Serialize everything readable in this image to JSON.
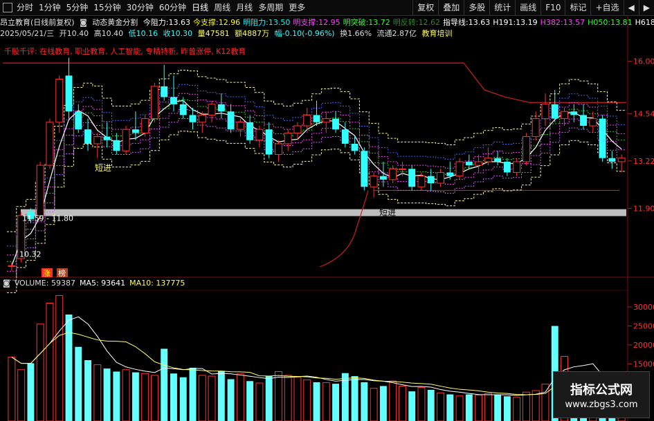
{
  "toolbar": {
    "periods": [
      "分时",
      "1分钟",
      "5分钟",
      "15分钟",
      "30分钟",
      "60分钟",
      "日线",
      "周线",
      "月线",
      "多周期",
      "更多"
    ],
    "active": "日线",
    "right": [
      "复权",
      "叠加",
      "多股",
      "统计",
      "画线",
      "F10",
      "标记",
      "+自选",
      "◀",
      "▶"
    ]
  },
  "info_line1": {
    "title": "昂立教育(日线前复权)",
    "indicator": "动态黄金分割",
    "items": [
      {
        "label": "今阻力:",
        "value": "13.63",
        "color": "#ffffff"
      },
      {
        "label": "今支撑:",
        "value": "12.96",
        "color": "#ffff00"
      },
      {
        "label": "明阻力:",
        "value": "13.50",
        "color": "#00ffff"
      },
      {
        "label": "明支撑:",
        "value": "12.95",
        "color": "#ff44ff"
      },
      {
        "label": "明突破:",
        "value": "13.72",
        "color": "#33ff33"
      },
      {
        "label": "明反转:",
        "value": "12.62",
        "color": "#338833"
      },
      {
        "label": "指导线:",
        "value": "13.63",
        "color": "#ffffff"
      },
      {
        "label": "H191:",
        "value": "13.19",
        "color": "#ffffff"
      },
      {
        "label": "H382:",
        "value": "13.57",
        "color": "#ff44ff"
      },
      {
        "label": "H050:",
        "value": "13.81",
        "color": "#33ff33"
      },
      {
        "label": "H618:",
        "value": "1",
        "color": "#ffffff"
      }
    ]
  },
  "info_line2": {
    "date": "2025/05/21/三",
    "open": "开10.40",
    "high": "高10.40",
    "low": "低10.16",
    "close": "收10.30",
    "volume": "量47581",
    "amount": "额4887万",
    "change": "幅-0.10(-0.96%)",
    "turnover": "换1.66%",
    "float": "流通2.87亿",
    "extra": "教育培训"
  },
  "annotation": "千股千评: 在线教育, 职业教育, 人工智能, 专精特新, 昨曾涨停, K12教育",
  "chart_data": [
    {
      "type": "candlestick",
      "name": "price",
      "yaxis_ticks": [
        16.0,
        14.54,
        13.22,
        11.9
      ],
      "text_labels": [
        "11.59 - 11.80",
        "10.32",
        "短进",
        "短进",
        "涨",
        "榜"
      ],
      "candles": [
        {
          "o": 10.3,
          "h": 10.4,
          "l": 10.16,
          "c": 10.3
        },
        {
          "o": 10.5,
          "h": 11.8,
          "l": 10.4,
          "c": 11.7
        },
        {
          "o": 11.8,
          "h": 11.9,
          "l": 11.5,
          "c": 11.6
        },
        {
          "o": 11.7,
          "h": 13.2,
          "l": 11.6,
          "c": 13.1
        },
        {
          "o": 13.1,
          "h": 14.4,
          "l": 13.0,
          "c": 14.3
        },
        {
          "o": 14.3,
          "h": 15.6,
          "l": 14.0,
          "c": 15.5
        },
        {
          "o": 15.6,
          "h": 16.1,
          "l": 14.4,
          "c": 14.6
        },
        {
          "o": 14.6,
          "h": 14.8,
          "l": 14.0,
          "c": 14.1
        },
        {
          "o": 14.1,
          "h": 14.4,
          "l": 13.5,
          "c": 13.7
        },
        {
          "o": 13.7,
          "h": 14.0,
          "l": 13.3,
          "c": 13.9
        },
        {
          "o": 13.9,
          "h": 14.3,
          "l": 13.6,
          "c": 13.8
        },
        {
          "o": 13.8,
          "h": 14.0,
          "l": 13.4,
          "c": 13.5
        },
        {
          "o": 13.5,
          "h": 14.2,
          "l": 13.4,
          "c": 14.1
        },
        {
          "o": 14.1,
          "h": 14.6,
          "l": 13.8,
          "c": 14.0
        },
        {
          "o": 14.0,
          "h": 14.5,
          "l": 13.9,
          "c": 14.4
        },
        {
          "o": 14.4,
          "h": 15.4,
          "l": 14.3,
          "c": 15.3
        },
        {
          "o": 15.3,
          "h": 15.9,
          "l": 14.9,
          "c": 15.0
        },
        {
          "o": 15.0,
          "h": 15.6,
          "l": 14.6,
          "c": 14.8
        },
        {
          "o": 14.8,
          "h": 15.0,
          "l": 14.4,
          "c": 14.5
        },
        {
          "o": 14.5,
          "h": 14.7,
          "l": 14.1,
          "c": 14.3
        },
        {
          "o": 14.3,
          "h": 14.6,
          "l": 14.0,
          "c": 14.5
        },
        {
          "o": 14.5,
          "h": 14.9,
          "l": 14.3,
          "c": 14.8
        },
        {
          "o": 14.8,
          "h": 15.1,
          "l": 14.4,
          "c": 14.6
        },
        {
          "o": 14.6,
          "h": 14.8,
          "l": 14.0,
          "c": 14.1
        },
        {
          "o": 14.1,
          "h": 14.4,
          "l": 13.9,
          "c": 14.3
        },
        {
          "o": 14.3,
          "h": 14.5,
          "l": 13.7,
          "c": 13.8
        },
        {
          "o": 13.8,
          "h": 14.2,
          "l": 13.6,
          "c": 14.1
        },
        {
          "o": 14.1,
          "h": 14.3,
          "l": 13.3,
          "c": 13.4
        },
        {
          "o": 13.4,
          "h": 13.8,
          "l": 13.2,
          "c": 13.7
        },
        {
          "o": 13.7,
          "h": 14.1,
          "l": 13.5,
          "c": 14.0
        },
        {
          "o": 14.0,
          "h": 14.3,
          "l": 13.8,
          "c": 14.2
        },
        {
          "o": 14.2,
          "h": 14.7,
          "l": 14.0,
          "c": 14.5
        },
        {
          "o": 14.5,
          "h": 14.9,
          "l": 14.2,
          "c": 14.3
        },
        {
          "o": 14.3,
          "h": 14.6,
          "l": 14.0,
          "c": 14.4
        },
        {
          "o": 14.4,
          "h": 14.6,
          "l": 14.0,
          "c": 14.1
        },
        {
          "o": 14.1,
          "h": 14.3,
          "l": 13.6,
          "c": 13.7
        },
        {
          "o": 13.7,
          "h": 13.9,
          "l": 13.4,
          "c": 13.5
        },
        {
          "o": 13.5,
          "h": 13.6,
          "l": 12.4,
          "c": 12.5
        },
        {
          "o": 12.5,
          "h": 12.9,
          "l": 12.2,
          "c": 12.8
        },
        {
          "o": 12.8,
          "h": 13.2,
          "l": 12.5,
          "c": 12.7
        },
        {
          "o": 12.7,
          "h": 13.1,
          "l": 12.6,
          "c": 13.0
        },
        {
          "o": 13.0,
          "h": 13.2,
          "l": 12.8,
          "c": 13.0
        },
        {
          "o": 13.0,
          "h": 13.1,
          "l": 12.4,
          "c": 12.5
        },
        {
          "o": 12.5,
          "h": 12.9,
          "l": 12.4,
          "c": 12.8
        },
        {
          "o": 12.8,
          "h": 13.0,
          "l": 12.4,
          "c": 12.6
        },
        {
          "o": 12.6,
          "h": 13.0,
          "l": 12.5,
          "c": 12.9
        },
        {
          "o": 12.9,
          "h": 13.2,
          "l": 12.7,
          "c": 12.8
        },
        {
          "o": 12.8,
          "h": 13.3,
          "l": 12.7,
          "c": 13.2
        },
        {
          "o": 13.2,
          "h": 13.4,
          "l": 13.0,
          "c": 13.1
        },
        {
          "o": 13.1,
          "h": 13.4,
          "l": 12.9,
          "c": 13.2
        },
        {
          "o": 13.2,
          "h": 13.6,
          "l": 13.1,
          "c": 13.3
        },
        {
          "o": 13.3,
          "h": 13.5,
          "l": 13.1,
          "c": 13.2
        },
        {
          "o": 13.2,
          "h": 13.3,
          "l": 12.8,
          "c": 12.9
        },
        {
          "o": 12.9,
          "h": 13.3,
          "l": 12.8,
          "c": 13.2
        },
        {
          "o": 13.2,
          "h": 14.0,
          "l": 13.1,
          "c": 13.9
        },
        {
          "o": 13.9,
          "h": 14.6,
          "l": 13.8,
          "c": 14.4
        },
        {
          "o": 14.4,
          "h": 15.1,
          "l": 14.2,
          "c": 14.8
        },
        {
          "o": 14.8,
          "h": 15.2,
          "l": 14.3,
          "c": 14.4
        },
        {
          "o": 14.4,
          "h": 14.7,
          "l": 14.2,
          "c": 14.6
        },
        {
          "o": 14.6,
          "h": 14.8,
          "l": 14.3,
          "c": 14.5
        },
        {
          "o": 14.5,
          "h": 14.8,
          "l": 14.1,
          "c": 14.2
        },
        {
          "o": 14.2,
          "h": 14.6,
          "l": 14.0,
          "c": 14.4
        },
        {
          "o": 14.4,
          "h": 14.5,
          "l": 13.2,
          "c": 13.3
        },
        {
          "o": 13.3,
          "h": 13.5,
          "l": 13.0,
          "c": 13.2
        },
        {
          "o": 13.2,
          "h": 13.4,
          "l": 12.9,
          "c": 13.3
        }
      ]
    },
    {
      "type": "bar",
      "name": "VOLUME",
      "legend": [
        {
          "label": "VOLUME",
          "value": "59387",
          "color": "#dddddd"
        },
        {
          "label": "MA5",
          "value": "93641",
          "color": "#ffffff"
        },
        {
          "label": "MA10",
          "value": "137775",
          "color": "#ffff66"
        }
      ],
      "yaxis_ticks": [
        30000,
        25000,
        20000,
        15000
      ],
      "values": [
        16800,
        13500,
        15200,
        25500,
        31000,
        33000,
        28000,
        19500,
        16000,
        14800,
        13800,
        13000,
        13500,
        12800,
        12500,
        12000,
        19000,
        12500,
        11500,
        14000,
        12000,
        11800,
        13200,
        11000,
        12400,
        10500,
        10000,
        11800,
        13000,
        12000,
        11500,
        10800,
        10200,
        10100,
        9800,
        12600,
        11800,
        10200,
        8600,
        9200,
        10500,
        9200,
        7800,
        8800,
        8200,
        7400,
        7000,
        6600,
        7000,
        6800,
        7200,
        6900,
        6500,
        6200,
        7600,
        8000,
        9700,
        25000,
        17000,
        11500,
        9800,
        12000,
        10000,
        11200,
        9500
      ]
    }
  ]
}
